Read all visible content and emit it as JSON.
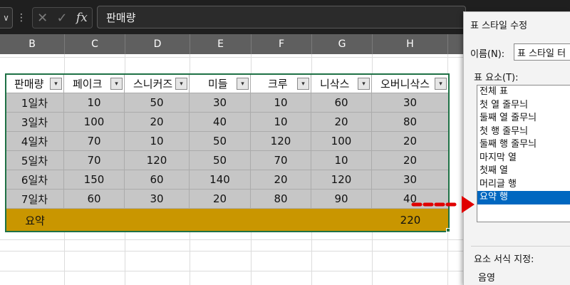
{
  "formula_bar": {
    "name_box_arrow": "∨",
    "menu_dots": "⋮",
    "cancel_icon": "✕",
    "enter_icon": "✓",
    "fx_label": "fx",
    "formula_value": "판매량"
  },
  "columns": [
    "B",
    "C",
    "D",
    "E",
    "F",
    "G",
    "H"
  ],
  "table": {
    "headers": [
      "판매량",
      "페이크",
      "스니커즈",
      "미들",
      "크루",
      "니삭스",
      "오버니삭스"
    ],
    "rows": [
      [
        "1일차",
        "10",
        "50",
        "30",
        "10",
        "60",
        "30"
      ],
      [
        "3일차",
        "100",
        "20",
        "40",
        "10",
        "20",
        "80"
      ],
      [
        "4일차",
        "70",
        "10",
        "50",
        "120",
        "100",
        "20"
      ],
      [
        "5일차",
        "70",
        "120",
        "50",
        "70",
        "10",
        "20"
      ],
      [
        "6일차",
        "150",
        "60",
        "140",
        "20",
        "120",
        "30"
      ],
      [
        "7일차",
        "60",
        "30",
        "20",
        "80",
        "90",
        "40"
      ]
    ],
    "summary_label": "요약",
    "summary_value": "220",
    "filter_glyph": "▾"
  },
  "dialog": {
    "title": "표 스타일 수정",
    "name_label": "이름(N):",
    "name_value": "표 스타일 터",
    "elements_label": "표 요소(T):",
    "elements": [
      "전체 표",
      "첫 열 줄무늬",
      "둘째 열 줄무늬",
      "첫 행 줄무늬",
      "둘째 행 줄무늬",
      "마지막 열",
      "첫째 열",
      "머리글 행",
      "요약 행"
    ],
    "selected_element": "요약 행",
    "format_label": "요소 서식 지정:",
    "format_value": "음영"
  },
  "colors": {
    "summary_fill": "#c99600",
    "body_fill": "#c6c6c6",
    "selection_border": "#1e7145",
    "list_selection": "#0067c0",
    "arrow": "#e00000"
  }
}
